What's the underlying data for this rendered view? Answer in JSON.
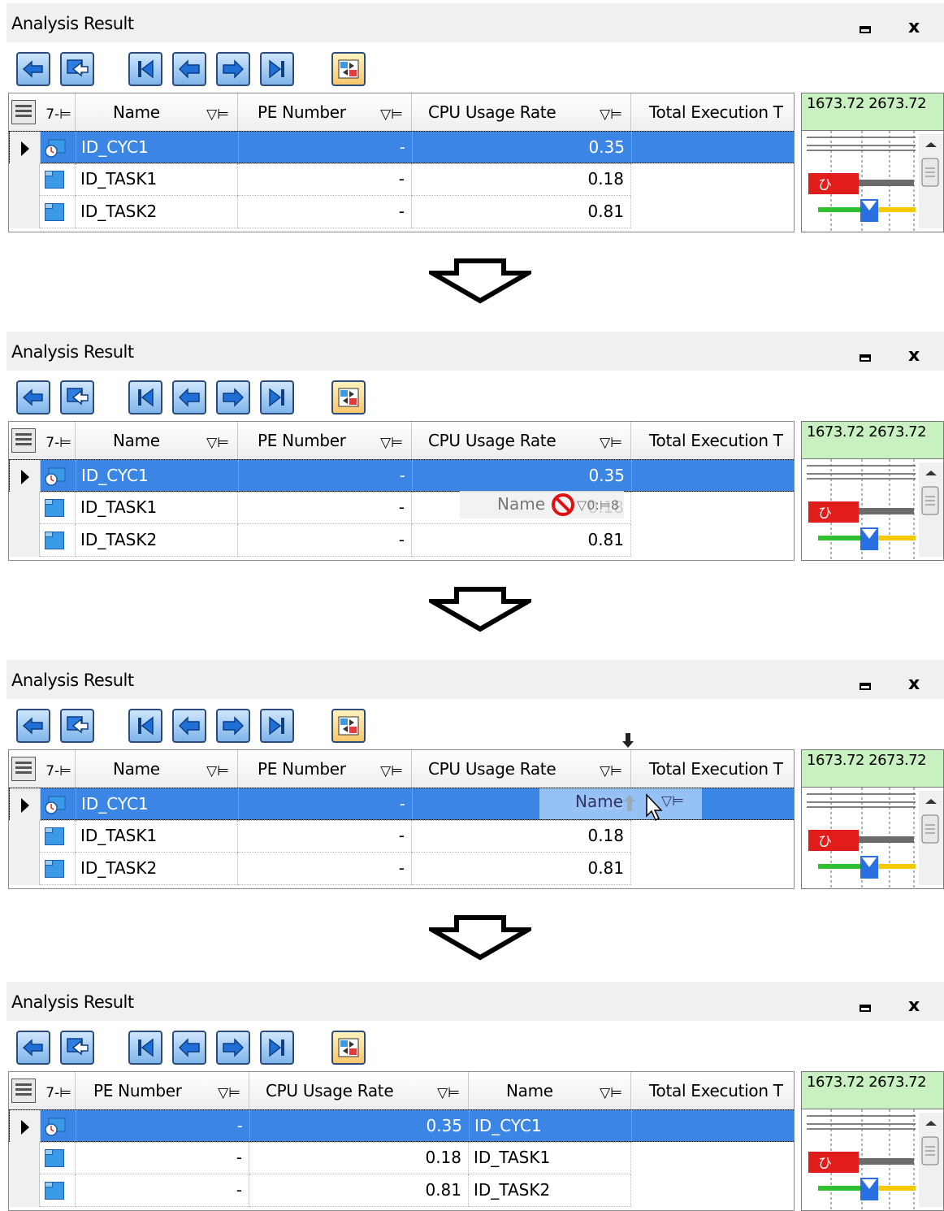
{
  "window": {
    "title": "Analysis Result",
    "minimize_icon": "minimize-icon",
    "close_label": "x"
  },
  "toolbar": {
    "icons": [
      "history-back-icon",
      "history-forward-icon",
      "first-icon",
      "previous-icon",
      "next-icon",
      "last-icon",
      "multi-select-icon"
    ]
  },
  "timeline": {
    "header": "1673.72 2673.72"
  },
  "columns_initial": {
    "corner_fp": "7-⊨",
    "name": "Name",
    "pe": "PE Number",
    "cpu": "CPU Usage Rate",
    "total": "Total Execution T",
    "filter_pin": "▽⊨"
  },
  "columns_final": {
    "c1": "PE Number",
    "c2": "CPU Usage Rate",
    "c3": "Name",
    "c4": "Total Execution T"
  },
  "rows": [
    {
      "name": "ID_CYC1",
      "pe": "-",
      "cpu": "0.35",
      "icon": "cyclic-handler-icon"
    },
    {
      "name": "ID_TASK1",
      "pe": "-",
      "cpu": "0.18",
      "icon": "task-icon"
    },
    {
      "name": "ID_TASK2",
      "pe": "-",
      "cpu": "0.81",
      "icon": "task-icon"
    }
  ],
  "drag_step2": {
    "label": "Name",
    "filter_text": "▽0:⊨8",
    "no_drop_icon": "no-drop-icon"
  },
  "drag_step3": {
    "label": "Name",
    "filter_pin": "▽⊨",
    "drop_marker": "drop-position-icon",
    "cursor": "mouse-cursor-icon"
  },
  "colors": {
    "selection": "#3b86e4",
    "timeline_header": "#c8f0c0",
    "gantt_red": "#e21b1b",
    "gantt_blue": "#2a6fe0",
    "gantt_green": "#2fbf2f",
    "gantt_yellow": "#f5c800"
  }
}
